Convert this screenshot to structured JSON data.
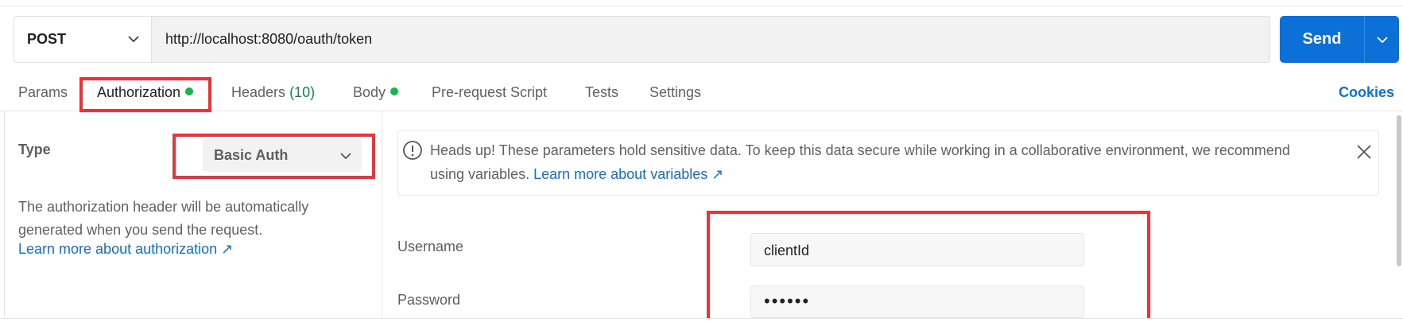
{
  "request": {
    "method": "POST",
    "url": "http://localhost:8080/oauth/token",
    "send_label": "Send"
  },
  "tabs": [
    {
      "label": "Params"
    },
    {
      "label": "Authorization",
      "indicator": "green-dot"
    },
    {
      "label": "Headers",
      "count": "(10)"
    },
    {
      "label": "Body",
      "indicator": "green-dot"
    },
    {
      "label": "Pre-request Script"
    },
    {
      "label": "Tests"
    },
    {
      "label": "Settings"
    }
  ],
  "cookies_label": "Cookies",
  "auth": {
    "type_label": "Type",
    "type_value": "Basic Auth",
    "description": "The authorization header will be automatically generated when you send the request.",
    "learn_more": "Learn more about authorization ↗"
  },
  "notice": {
    "text": "Heads up! These parameters hold sensitive data. To keep this data secure while working in a collaborative environment, we recommend using variables.",
    "link": "Learn more about variables ↗"
  },
  "fields": {
    "username_label": "Username",
    "username_value": "clientId",
    "password_label": "Password",
    "password_value": "••••••"
  },
  "colors": {
    "accent": "#0c70d9",
    "highlight": "#ee3338",
    "indicator": "#14b64a"
  }
}
